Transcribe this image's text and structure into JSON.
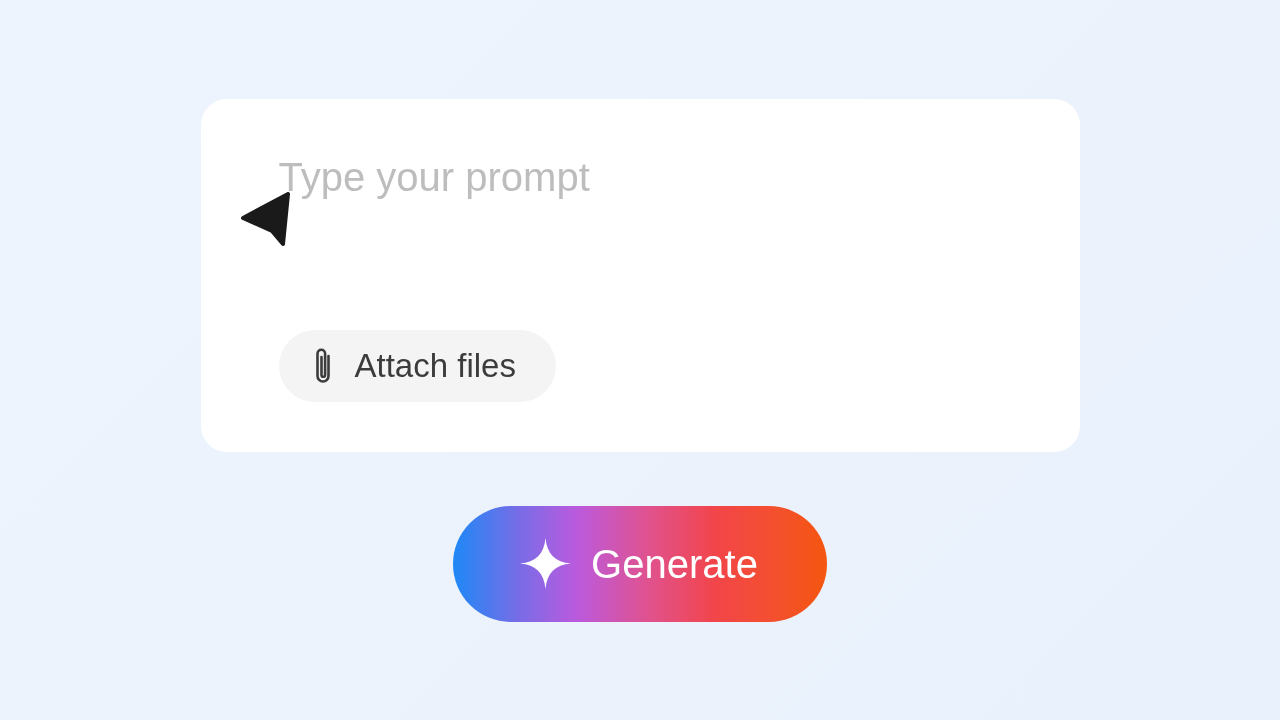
{
  "prompt": {
    "placeholder": "Type your prompt"
  },
  "attach_button": {
    "label": "Attach files"
  },
  "generate_button": {
    "label": "Generate"
  }
}
